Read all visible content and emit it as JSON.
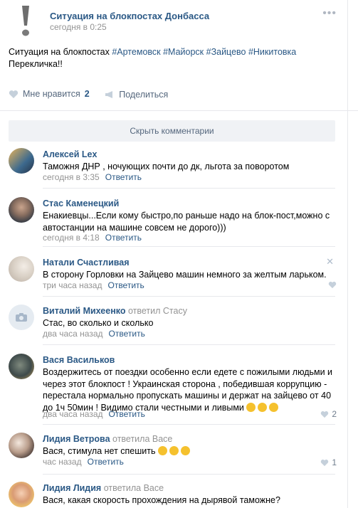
{
  "post": {
    "title": "Ситуация на блокпостах Донбасса",
    "time": "сегодня в 0:25",
    "text_line1_plain": "Ситуация на блокпостах ",
    "text_line1_tags": "#Артемовск #Майорск #Зайцево #Никитовка",
    "text_line2": "Перекличка!!",
    "like_label": "Мне нравится",
    "like_count": "2",
    "share_label": "Поделиться",
    "menu": "•••"
  },
  "hide_comments": "Скрыть комментарии",
  "comments": [
    {
      "author": "Алексей Lex",
      "replied": "",
      "text": "Таможня ДНР , ночующих почти до дк, льгота за поворотом",
      "time": "сегодня в 3:35",
      "reply": "Ответить",
      "likes": ""
    },
    {
      "author": "Стас Каменецкий",
      "replied": "",
      "text": "Енакиевцы...Если кому быстро,по раньше надо на блок-пост,можно с автостанции на машине совсем не дорого)))",
      "time": "сегодня в 4:18",
      "reply": "Ответить",
      "likes": ""
    },
    {
      "author": "Натали Счастливая",
      "replied": "",
      "text": "В сторону Горловки на Зайцево машин немного за желтым ларьком.",
      "time": "три часа назад",
      "reply": "Ответить",
      "likes": ""
    },
    {
      "author": "Виталий Михеенко",
      "replied": "ответил Стасу",
      "text": "Стас, во сколько и сколько",
      "time": "два часа назад",
      "reply": "Ответить",
      "likes": ""
    },
    {
      "author": "Вася Васильков",
      "replied": "",
      "text": "Воздержитесь от поездки особенно если едете с пожилыми людьми и через этот блокпост ! Украинская сторона , победившая коррупцию - перестала нормально пропускать машины и держат на зайцево от 40 до 1ч 50мин ! Видимо стали честными и ливыми",
      "time": "два часа назад",
      "reply": "Ответить",
      "likes": "2"
    },
    {
      "author": "Лидия Ветрова",
      "replied": "ответила Васе",
      "text": "Вася, стимула нет спешить",
      "time": "час назад",
      "reply": "Ответить",
      "likes": "1"
    },
    {
      "author": "Лидия Лидия",
      "replied": "ответила Васе",
      "text": "Вася, какая скорость прохождения на дырявой таможне?",
      "time": "",
      "reply": "",
      "likes": ""
    }
  ],
  "colors": {
    "link": "#2a5885",
    "muted": "#939393",
    "bg_button": "#f0f2f5"
  }
}
